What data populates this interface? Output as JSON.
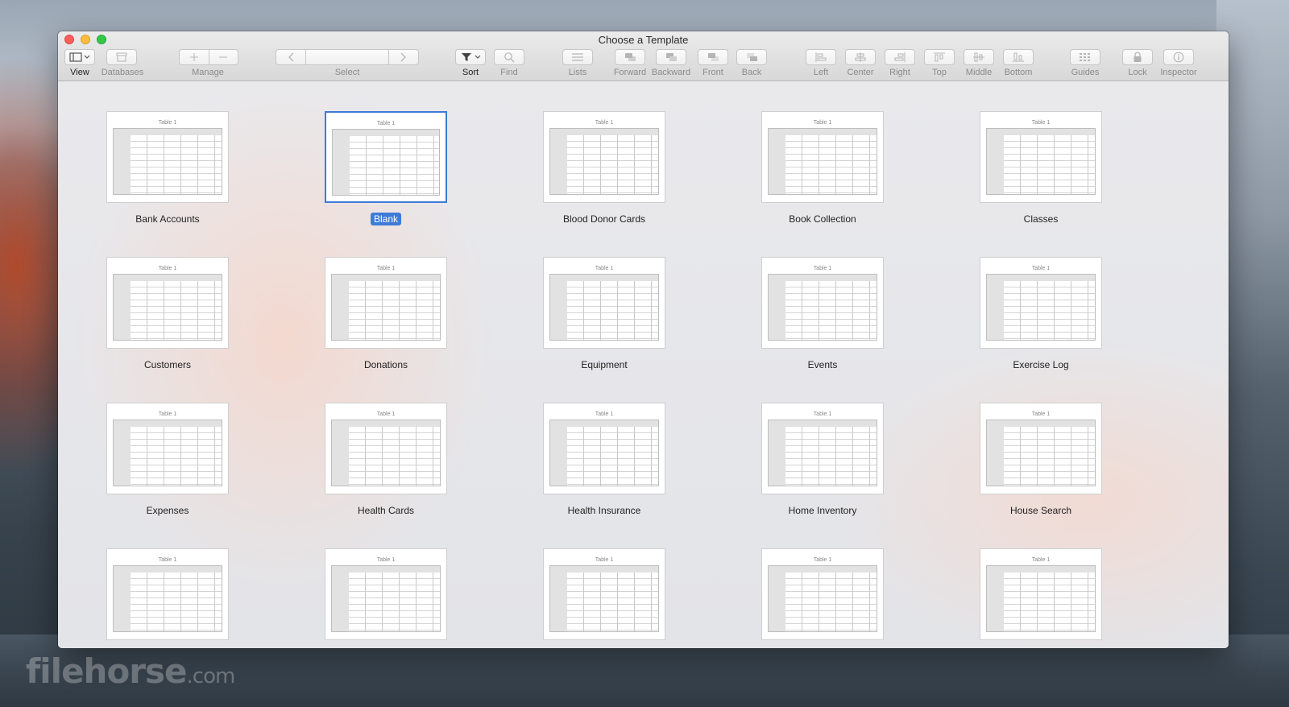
{
  "window": {
    "title": "Choose a Template"
  },
  "toolbar": {
    "view": "View",
    "databases": "Databases",
    "manage": "Manage",
    "select": "Select",
    "sort": "Sort",
    "find": "Find",
    "lists": "Lists",
    "forward": "Forward",
    "backward": "Backward",
    "front": "Front",
    "back": "Back",
    "left": "Left",
    "center": "Center",
    "right": "Right",
    "top": "Top",
    "middle": "Middle",
    "bottom": "Bottom",
    "guides": "Guides",
    "lock": "Lock",
    "inspector": "Inspector"
  },
  "templates": [
    {
      "name": "Bank Accounts",
      "table_title": "Table 1",
      "selected": false
    },
    {
      "name": "Blank",
      "table_title": "Table 1",
      "selected": true
    },
    {
      "name": "Blood Donor Cards",
      "table_title": "Table 1",
      "selected": false
    },
    {
      "name": "Book Collection",
      "table_title": "Table 1",
      "selected": false
    },
    {
      "name": "Classes",
      "table_title": "Table 1",
      "selected": false
    },
    {
      "name": "Customers",
      "table_title": "Table 1",
      "selected": false
    },
    {
      "name": "Donations",
      "table_title": "Table 1",
      "selected": false
    },
    {
      "name": "Equipment",
      "table_title": "Table 1",
      "selected": false
    },
    {
      "name": "Events",
      "table_title": "Table 1",
      "selected": false
    },
    {
      "name": "Exercise Log",
      "table_title": "Table 1",
      "selected": false
    },
    {
      "name": "Expenses",
      "table_title": "Table 1",
      "selected": false
    },
    {
      "name": "Health Cards",
      "table_title": "Table 1",
      "selected": false
    },
    {
      "name": "Health Insurance",
      "table_title": "Table 1",
      "selected": false
    },
    {
      "name": "Home Inventory",
      "table_title": "Table 1",
      "selected": false
    },
    {
      "name": "House Search",
      "table_title": "Table 1",
      "selected": false
    },
    {
      "name": "",
      "table_title": "Table 1",
      "selected": false
    },
    {
      "name": "",
      "table_title": "Table 1",
      "selected": false
    },
    {
      "name": "",
      "table_title": "Table 1",
      "selected": false
    },
    {
      "name": "",
      "table_title": "Table 1",
      "selected": false
    },
    {
      "name": "",
      "table_title": "Table 1",
      "selected": false
    }
  ],
  "watermark": {
    "brand": "filehorse",
    "suffix": ".com"
  },
  "colors": {
    "selection": "#3d7bd9",
    "close": "#fc605c",
    "minimize": "#fdbc40",
    "maximize": "#34c84a"
  }
}
